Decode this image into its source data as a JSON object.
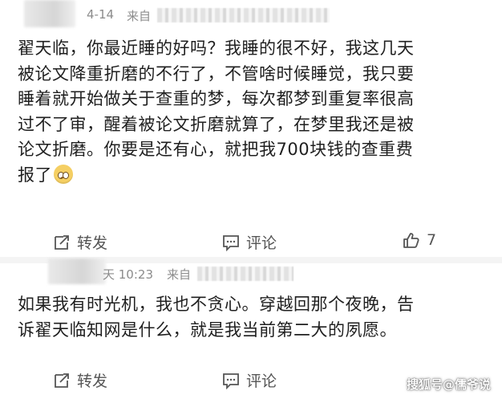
{
  "posts": [
    {
      "header": {
        "date_fragment": "4-14",
        "from_label": "来自"
      },
      "body": {
        "lines": [
          "翟天临，你最近睡的好吗？我睡的很不好，我这几天",
          "被论文降重折磨的不行了，不管啥时候睡觉，我只要",
          "睡着就开始做关于查重的梦，每次都梦到重复率很高",
          "过不了审，醒着被论文折磨就算了，在梦里我还是被",
          "论文折磨。你要是还有心，就把我700块钱的查重费",
          "报了"
        ],
        "emoji": "pleading-face-emoji"
      },
      "actions": {
        "repost_label": "转发",
        "comment_label": "评论",
        "like_count": "7"
      }
    },
    {
      "header": {
        "date_fragment": "天 10:23",
        "from_label": "来自"
      },
      "body": {
        "lines": [
          "如果我有时光机，我也不贪心。穿越回那个夜晚，告",
          "诉翟天临知网是什么，就是我当前第二大的夙愿。"
        ]
      },
      "actions": {
        "repost_label": "转发",
        "comment_label": "评论"
      }
    }
  ],
  "watermark": "搜狐号@儒爷说",
  "icons": {
    "repost": "repost-icon",
    "comment": "comment-icon",
    "like": "thumbs-up-icon"
  },
  "colors": {
    "text": "#1f1f1f",
    "meta": "#8c8c8c",
    "action": "#555555",
    "divider": "#f4f4f4"
  }
}
